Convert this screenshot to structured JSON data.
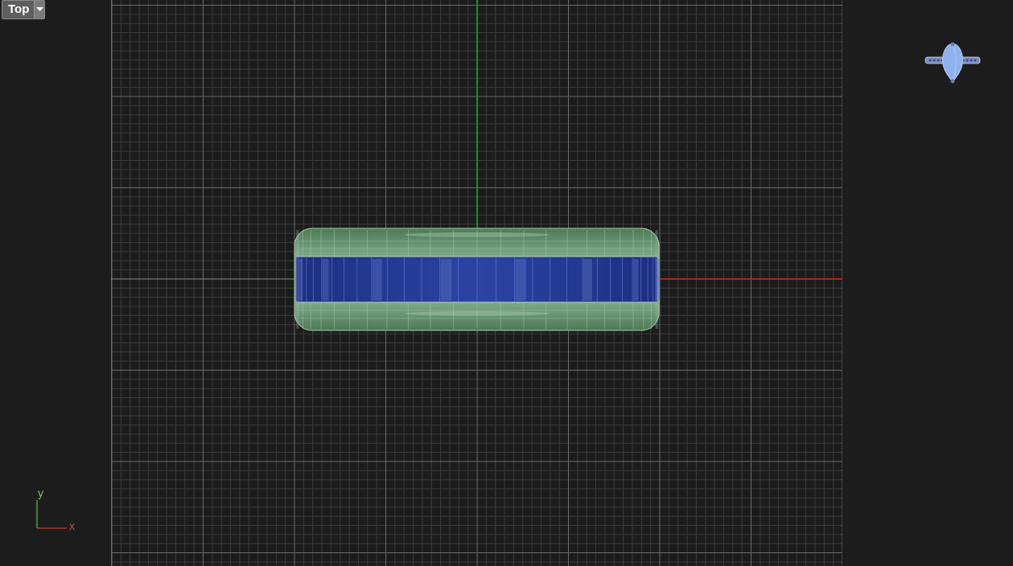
{
  "viewport": {
    "view_name": "Top",
    "axes": {
      "x_label": "x",
      "y_label": "y"
    }
  },
  "colors": {
    "background": "#1c1c1c",
    "grid_minor": "#3a3a3a",
    "grid_major": "#6a6a6a",
    "axis_x": "#e02020",
    "axis_y": "#2faa2f",
    "ring_band": "#5f8f67",
    "gems": "#2a3f9a"
  },
  "icons": {
    "view_menu": "chevron-down-icon",
    "preview": "ring-preview-icon"
  }
}
